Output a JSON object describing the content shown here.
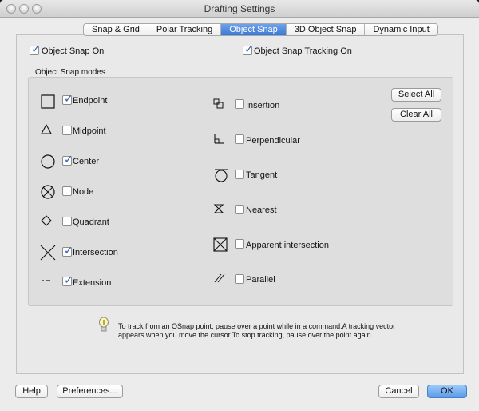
{
  "window": {
    "title": "Drafting Settings"
  },
  "tabs": [
    {
      "label": "Snap & Grid",
      "active": false
    },
    {
      "label": "Polar Tracking",
      "active": false
    },
    {
      "label": "Object Snap",
      "active": true
    },
    {
      "label": "3D Object Snap",
      "active": false
    },
    {
      "label": "Dynamic Input",
      "active": false
    }
  ],
  "options": {
    "snap_on": {
      "label": "Object Snap On",
      "checked": true
    },
    "tracking_on": {
      "label": "Object Snap Tracking On",
      "checked": true
    }
  },
  "modes_group": {
    "title": "Object Snap modes",
    "left": [
      {
        "label": "Endpoint",
        "checked": true,
        "icon": "endpoint-icon"
      },
      {
        "label": "Midpoint",
        "checked": false,
        "icon": "midpoint-icon"
      },
      {
        "label": "Center",
        "checked": true,
        "icon": "center-icon"
      },
      {
        "label": "Node",
        "checked": false,
        "icon": "node-icon"
      },
      {
        "label": "Quadrant",
        "checked": false,
        "icon": "quadrant-icon"
      },
      {
        "label": "Intersection",
        "checked": true,
        "icon": "intersection-icon"
      },
      {
        "label": "Extension",
        "checked": true,
        "icon": "extension-icon"
      }
    ],
    "right": [
      {
        "label": "Insertion",
        "checked": false,
        "icon": "insertion-icon"
      },
      {
        "label": "Perpendicular",
        "checked": false,
        "icon": "perpendicular-icon"
      },
      {
        "label": "Tangent",
        "checked": false,
        "icon": "tangent-icon"
      },
      {
        "label": "Nearest",
        "checked": false,
        "icon": "nearest-icon"
      },
      {
        "label": "Apparent intersection",
        "checked": false,
        "icon": "apparent-intersection-icon"
      },
      {
        "label": "Parallel",
        "checked": false,
        "icon": "parallel-icon"
      }
    ],
    "select_all": "Select All",
    "clear_all": "Clear All"
  },
  "hint": "To track from an OSnap point, pause over a point while in a command.A tracking vector appears when you move the cursor.To stop tracking, pause over the point again.",
  "footer": {
    "help": "Help",
    "preferences": "Preferences...",
    "cancel": "Cancel",
    "ok": "OK"
  }
}
